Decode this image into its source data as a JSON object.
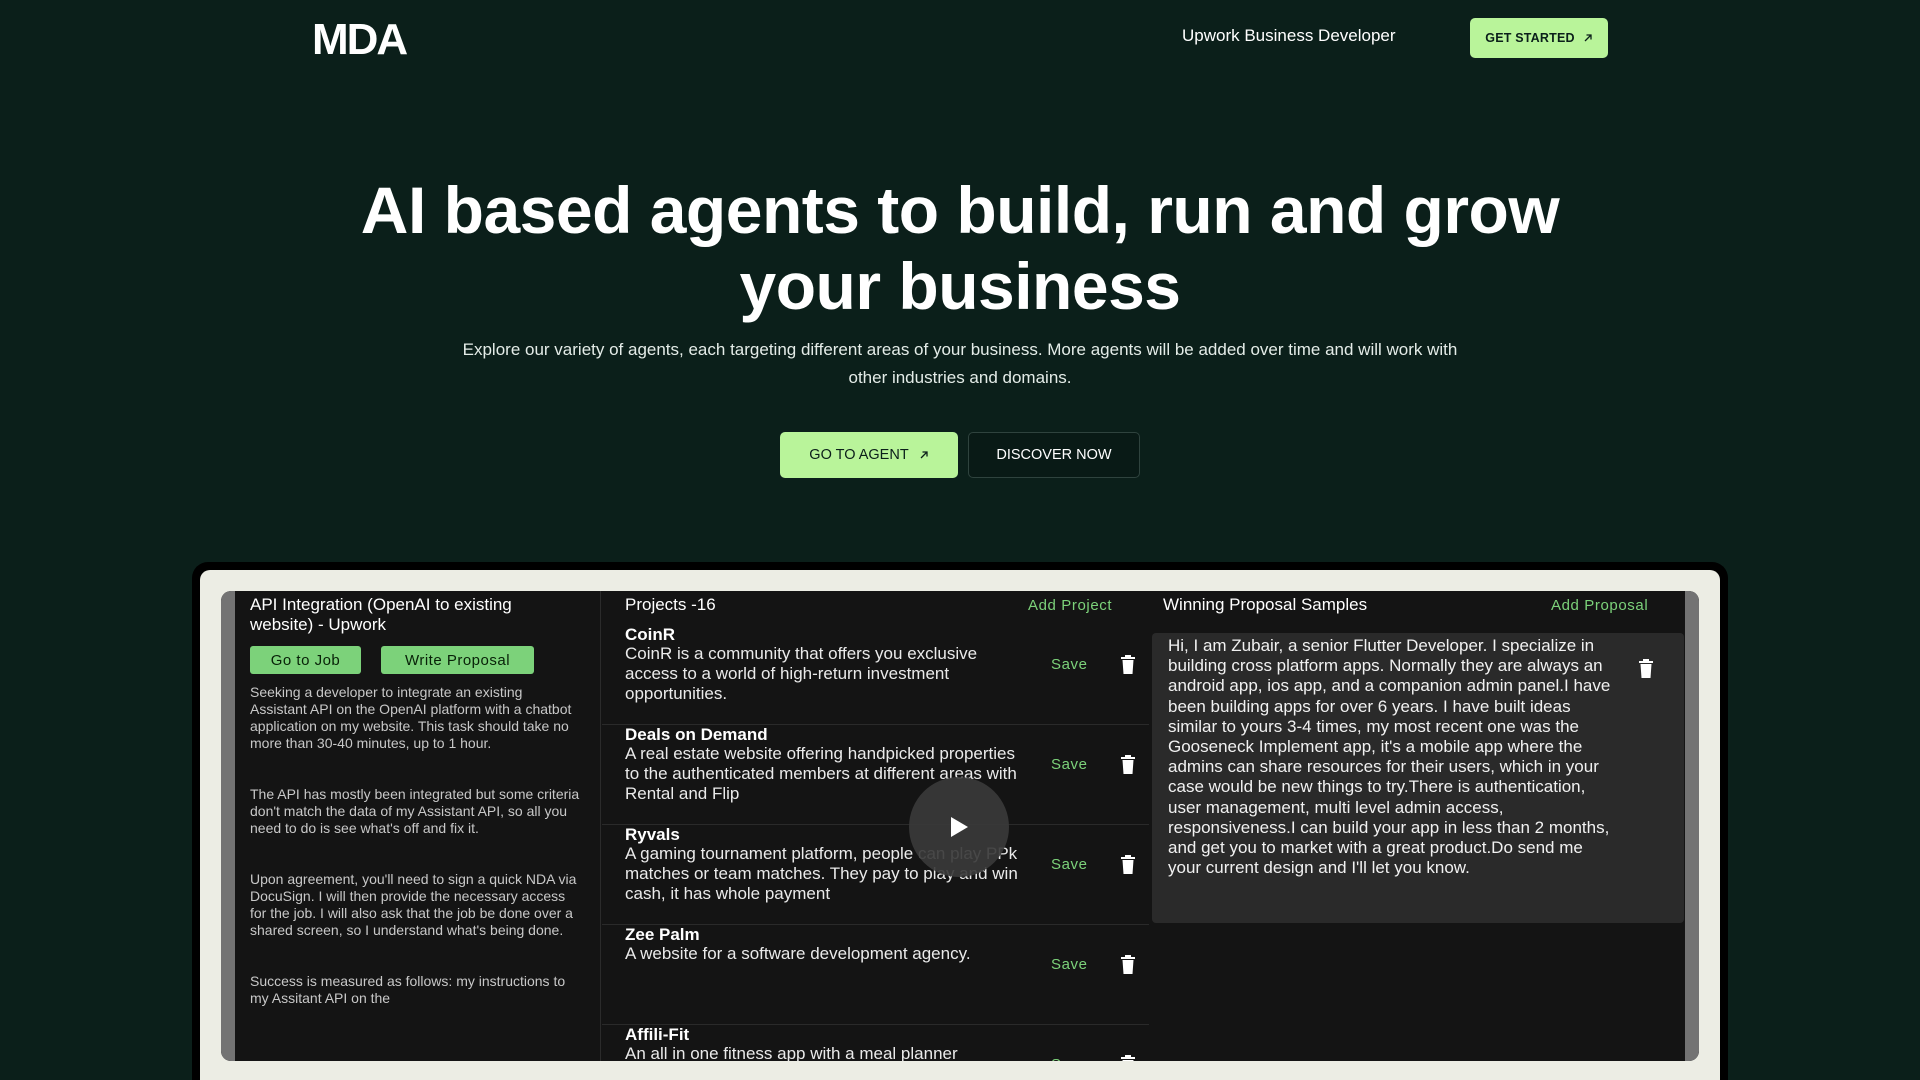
{
  "header": {
    "logo_text": "MDA",
    "nav_link": "Upwork Business Developer",
    "cta_label": "GET STARTED",
    "cta_icon": "arrow-up-right-icon"
  },
  "hero": {
    "title_line1": "AI based agents to build, run and grow",
    "title_line2": "your business",
    "subtitle_line1": "Explore our variety of agents, each targeting different areas of your business. More agents will be added over time and will work with",
    "subtitle_line2": "other industries and domains.",
    "primary_button": "GO TO AGENT",
    "secondary_button": "DISCOVER NOW"
  },
  "preview": {
    "job": {
      "title": "API Integration (OpenAI to existing website) - Upwork",
      "go_to_job": "Go to Job",
      "write_proposal": "Write Proposal",
      "description": [
        "Seeking a developer to integrate an existing Assistant API on the OpenAI platform with a chatbot application on my website. This task should take no more than 30-40 minutes, up to 1 hour.",
        "The API has mostly been integrated but some criteria don't match the data of my Assistant API, so all you need to do is see what's off and fix it.",
        "Upon agreement, you'll need to sign a quick NDA via DocuSign. I will then provide the necessary access for the job. I will also ask that the job be done over a shared screen, so I understand what's being done.",
        "Success is measured as follows: my instructions to my Assitant API on the"
      ]
    },
    "projects": {
      "heading": "Projects -16",
      "add_label": "Add Project",
      "save_label": "Save",
      "items": [
        {
          "name": "CoinR",
          "description": "CoinR is a community that offers you exclusive access to a world of high-return investment opportunities."
        },
        {
          "name": "Deals on Demand",
          "description": "A real estate website offering handpicked properties to the authenticated members at different areas with Rental and Flip"
        },
        {
          "name": "Ryvals",
          "description": "A gaming tournament platform, people can play PPk matches or team matches. They pay to play and win cash, it has whole payment"
        },
        {
          "name": "Zee Palm",
          "description": "A website for a software development agency."
        },
        {
          "name": "Affili-Fit",
          "description": "An all in one fitness app with a meal planner"
        }
      ]
    },
    "proposals": {
      "heading": "Winning Proposal Samples",
      "add_label": "Add Proposal",
      "sample": "Hi, I am Zubair, a senior Flutter Developer. I specialize in building cross platform apps. Normally they are always an android app, ios app, and a companion admin panel.I have been building apps for over 6 years. I have built ideas similar to yours 3-4 times, my most recent one was the Gooseneck Implement app, it's a mobile app where the admins can share resources for their users, which in your case would be new things to try.There is authentication, user management, multi level admin access, responsiveness.I can build your app in less than 2 months, and get you to market with a great product.Do send me your current design and I'll let you know."
    },
    "video_icon": "play-icon"
  },
  "colors": {
    "background": "#0b1f1a",
    "accent": "#b9f49a",
    "app_green": "#7cd27a"
  }
}
